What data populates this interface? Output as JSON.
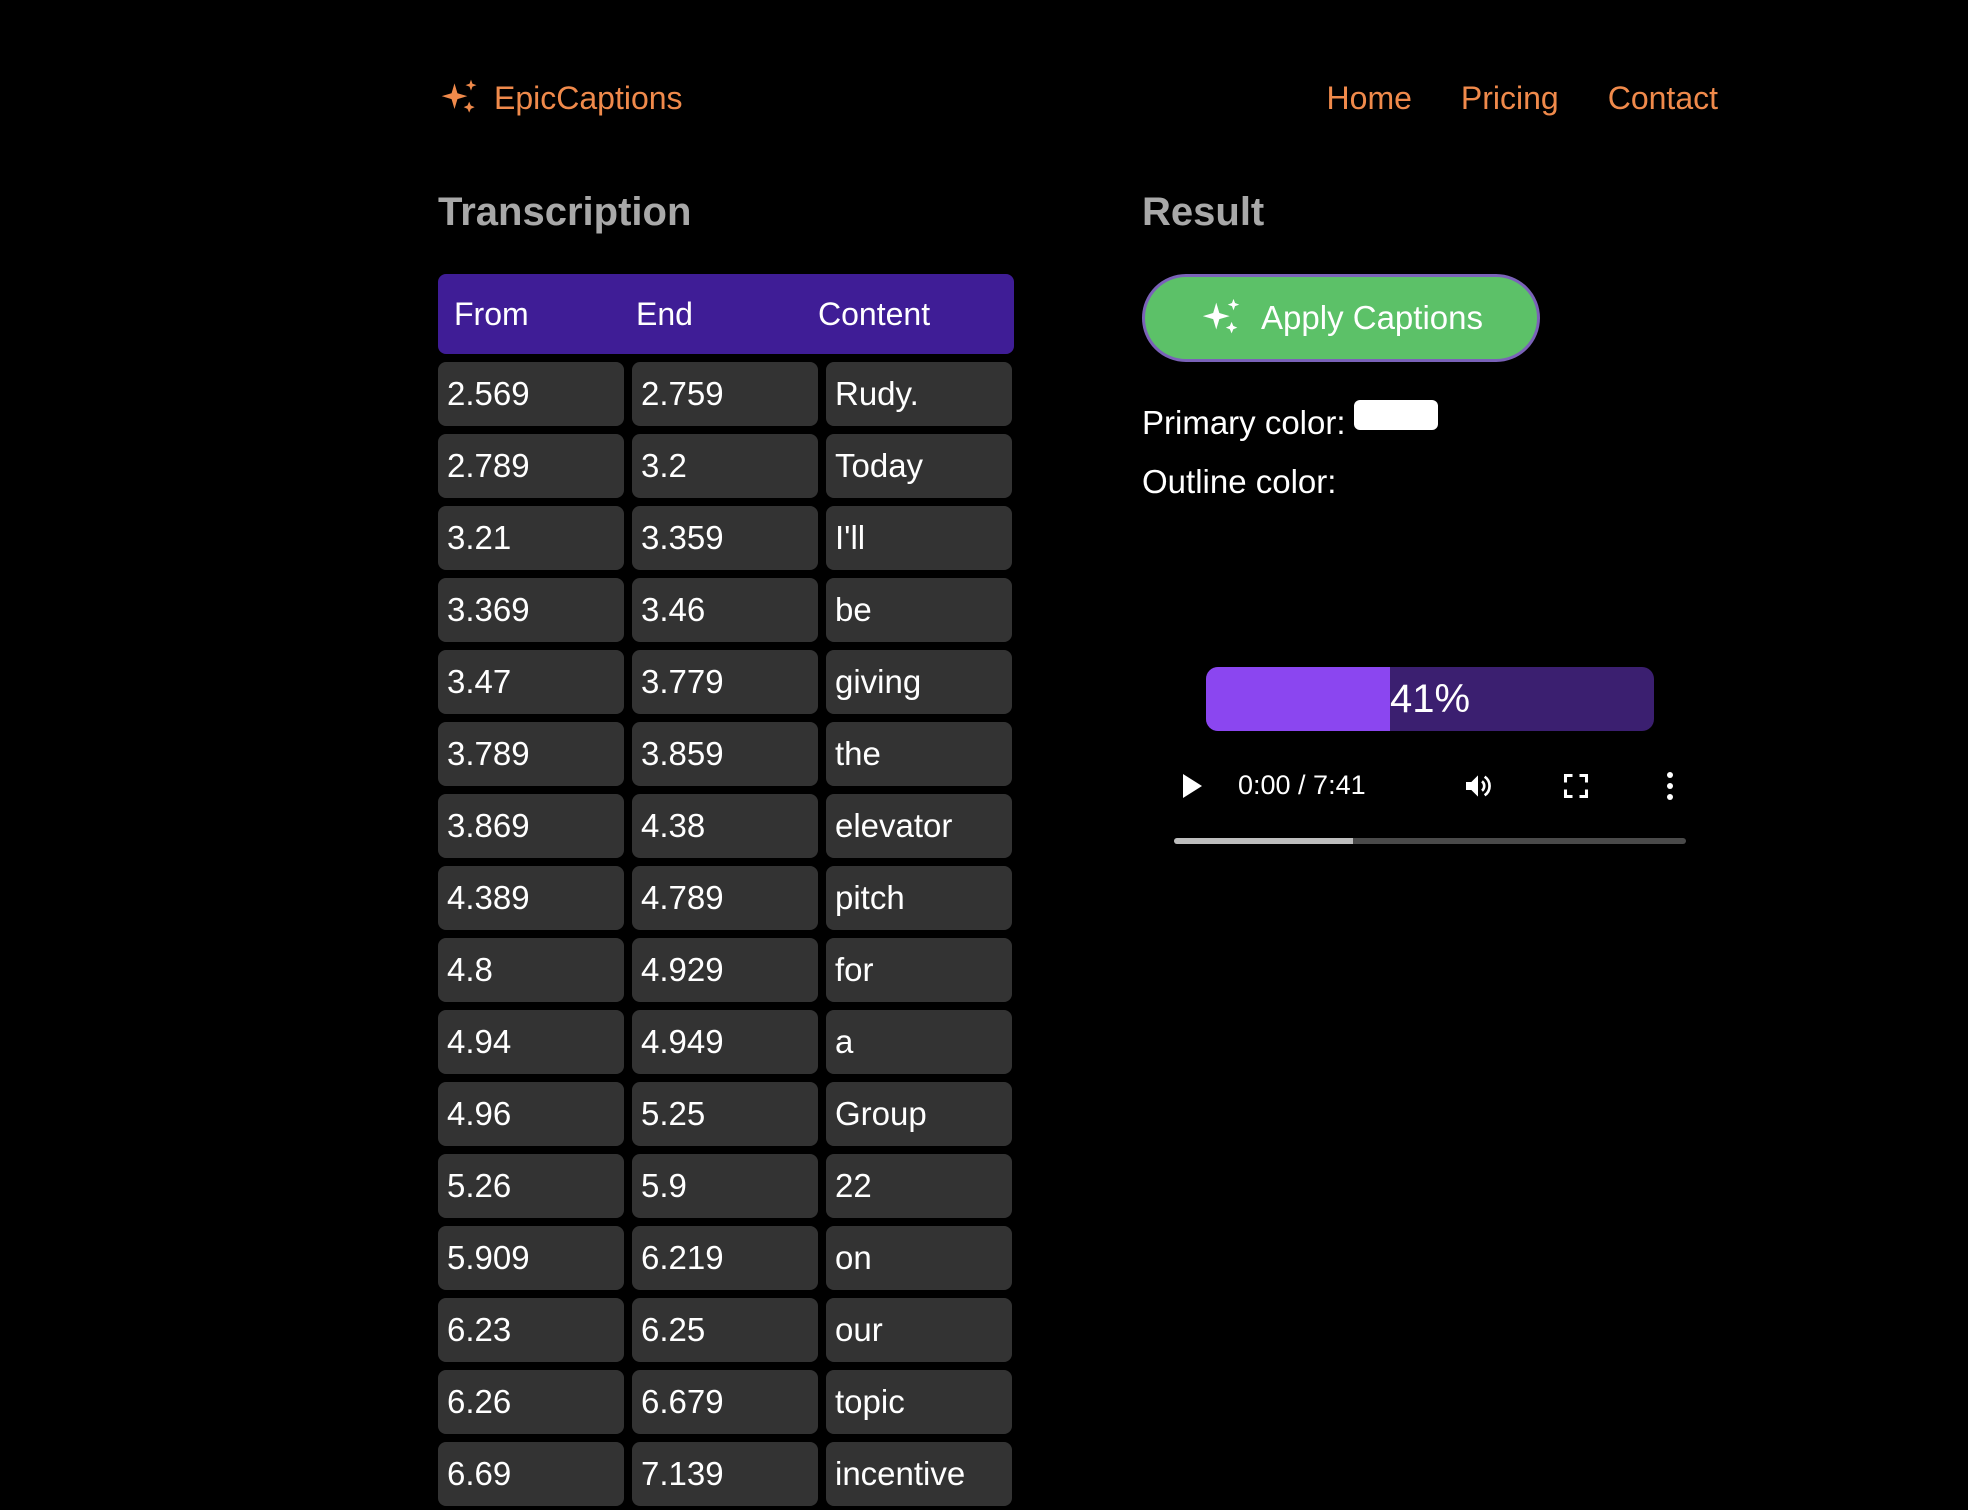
{
  "header": {
    "brand": "EpicCaptions",
    "nav": [
      {
        "label": "Home"
      },
      {
        "label": "Pricing"
      },
      {
        "label": "Contact"
      }
    ]
  },
  "transcription": {
    "title": "Transcription",
    "columns": [
      "From",
      "End",
      "Content"
    ],
    "rows": [
      {
        "from": "2.569",
        "end": "2.759",
        "content": "Rudy."
      },
      {
        "from": "2.789",
        "end": "3.2",
        "content": "Today"
      },
      {
        "from": "3.21",
        "end": "3.359",
        "content": "I'll"
      },
      {
        "from": "3.369",
        "end": "3.46",
        "content": "be"
      },
      {
        "from": "3.47",
        "end": "3.779",
        "content": "giving"
      },
      {
        "from": "3.789",
        "end": "3.859",
        "content": "the"
      },
      {
        "from": "3.869",
        "end": "4.38",
        "content": "elevator"
      },
      {
        "from": "4.389",
        "end": "4.789",
        "content": "pitch"
      },
      {
        "from": "4.8",
        "end": "4.929",
        "content": "for"
      },
      {
        "from": "4.94",
        "end": "4.949",
        "content": "a"
      },
      {
        "from": "4.96",
        "end": "5.25",
        "content": "Group"
      },
      {
        "from": "5.26",
        "end": "5.9",
        "content": "22"
      },
      {
        "from": "5.909",
        "end": "6.219",
        "content": "on"
      },
      {
        "from": "6.23",
        "end": "6.25",
        "content": "our"
      },
      {
        "from": "6.26",
        "end": "6.679",
        "content": "topic"
      },
      {
        "from": "6.69",
        "end": "7.139",
        "content": "incentive"
      }
    ]
  },
  "result": {
    "title": "Result",
    "apply_label": "Apply Captions",
    "primary_color_label": "Primary color:",
    "primary_color_value": "#ffffff",
    "outline_color_label": "Outline color:",
    "progress_label": "41%",
    "progress_value": 41
  },
  "player": {
    "time": "0:00 / 7:41",
    "buffered_fraction": 0.35
  },
  "colors": {
    "accent": "#f08a4b",
    "table_header": "#3f1d96",
    "cell_bg": "#333333",
    "button_green": "#5cc168",
    "progress_fill": "#8b46f0",
    "progress_track": "#3b1f70"
  }
}
